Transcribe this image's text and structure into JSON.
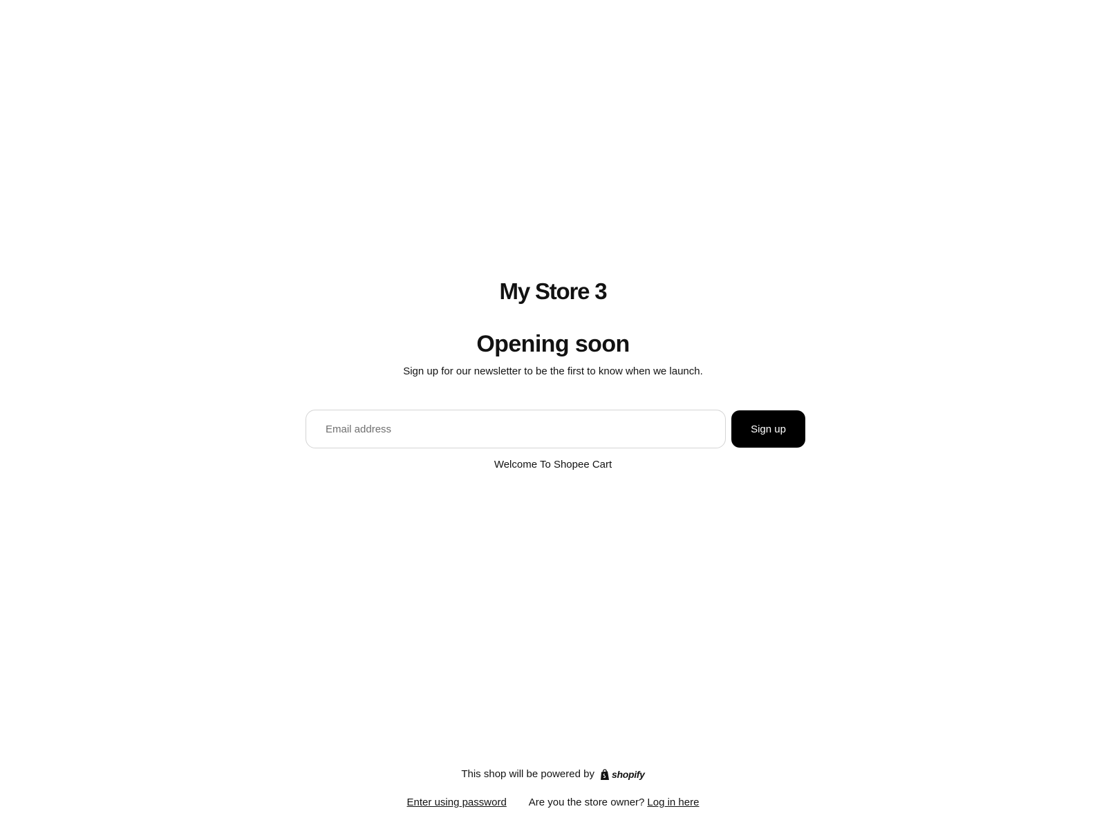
{
  "store": {
    "name": "My Store 3"
  },
  "main": {
    "heading": "Opening soon",
    "subtext": "Sign up for our newsletter to be the first to know when we launch.",
    "email_placeholder": "Email address",
    "email_value": "",
    "signup_label": "Sign up",
    "welcome": "Welcome To Shopee Cart"
  },
  "footer": {
    "powered_by": "This shop will be powered by",
    "shopify_word": "shopify",
    "enter_password": "Enter using password",
    "owner_question": "Are you the store owner?",
    "login_link": "Log in here"
  },
  "icons": {
    "shopify": "shopify-bag-icon"
  },
  "colors": {
    "button_bg": "#000000",
    "text": "#121212",
    "border": "#d4d4d4"
  }
}
